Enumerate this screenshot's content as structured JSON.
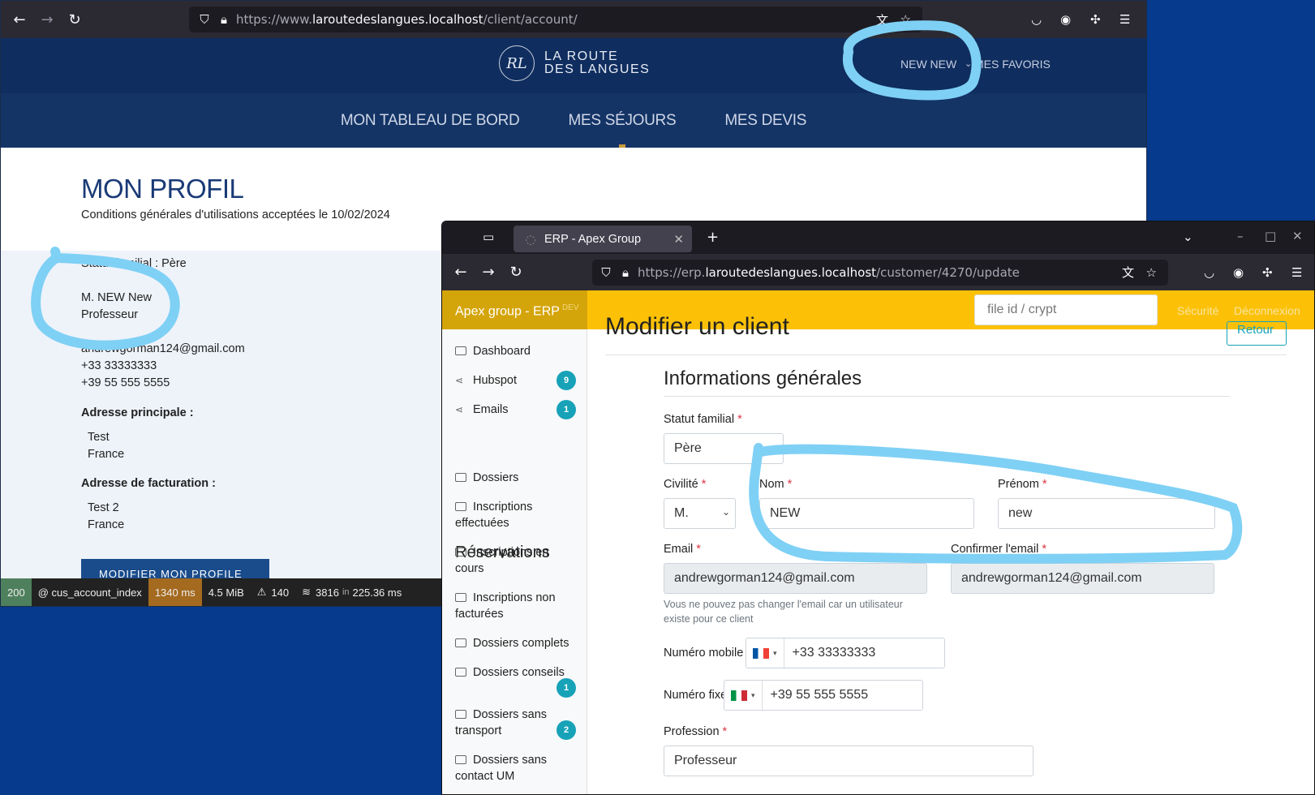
{
  "browser1": {
    "url_prefix": "https://www.",
    "url_host": "laroutedeslangues.localhost",
    "url_path": "/client/account/"
  },
  "site": {
    "logo_monogram": "RL",
    "logo_line1": "LA ROUTE",
    "logo_line2": "DES LANGUES",
    "user_menu": "NEW NEW",
    "favorites": "MES FAVORIS",
    "nav": [
      "MON TABLEAU DE BORD",
      "MES SÉJOURS",
      "MES DEVIS"
    ],
    "active_nav": "MES SÉJOURS"
  },
  "profile": {
    "title": "MON PROFIL",
    "cgu": "Conditions générales d'utilisations acceptées le 10/02/2024",
    "statut": "Statut familial : Père",
    "name": "M. NEW New",
    "profession": "Professeur",
    "email": "andrewgorman124@gmail.com",
    "phone1": "+33 33333333",
    "phone2": "+39 55 555 5555",
    "addr_main_label": "Adresse principale :",
    "addr_main_line1": "Test",
    "addr_main_line2": "France",
    "addr_bill_label": "Adresse de facturation :",
    "addr_bill_line1": "Test 2",
    "addr_bill_line2": "France",
    "edit_button": "MODIFIER MON PROFILE"
  },
  "debug": {
    "status": "200",
    "route": "@ cus_account_index",
    "time": "1340 ms",
    "memory": "4.5 MiB",
    "logs": "140",
    "cache_count": "3816",
    "cache_time": "225.36 ms"
  },
  "browser2": {
    "tab_title": "ERP - Apex Group",
    "url_prefix": "https://erp.",
    "url_host": "laroutedeslangues.localhost",
    "url_path": "/customer/4270/update"
  },
  "erp": {
    "brand": "Apex group - ERP",
    "brand_tag": "DEV",
    "search_placeholder": "file id / crypt",
    "link_security": "Sécurité",
    "link_logout": "Déconnexion",
    "page_title": "Modifier un client",
    "back_button": "Retour",
    "sidebar": {
      "dashboard": "Dashboard",
      "hubspot": "Hubspot",
      "hubspot_badge": "9",
      "emails": "Emails",
      "emails_badge": "1",
      "reservations_heading": "Réservations",
      "dossiers": "Dossiers",
      "inscriptions_effectuees": "Inscriptions effectuées",
      "inscriptions_en_cours": "Inscriptions en cours",
      "inscriptions_non_facturees": "Inscriptions non facturées",
      "dossiers_complets": "Dossiers complets",
      "dossiers_conseils": "Dossiers conseils",
      "dossiers_conseils_badge": "1",
      "dossiers_sans_transport": "Dossiers sans transport",
      "dossiers_sans_transport_badge": "2",
      "dossiers_sans_contact": "Dossiers sans contact UM"
    },
    "form": {
      "section_title": "Informations générales",
      "statut_label": "Statut familial",
      "statut_value": "Père",
      "civilite_label": "Civilité",
      "civilite_value": "M.",
      "nom_label": "Nom",
      "nom_value": "NEW",
      "prenom_label": "Prénom",
      "prenom_value": "new",
      "email_label": "Email",
      "email_value": "andrewgorman124@gmail.com",
      "confirm_email_label": "Confirmer l'email",
      "confirm_email_value": "andrewgorman124@gmail.com",
      "email_help": "Vous ne pouvez pas changer l'email car un utilisateur existe pour ce client",
      "mobile_label": "Numéro mobile",
      "mobile_value": "+33 33333333",
      "fixe_label": "Numéro fixe",
      "fixe_value": "+39 55 555 5555",
      "profession_label": "Profession",
      "profession_value": "Professeur",
      "required_mark": "*"
    }
  },
  "colors": {
    "desktop": "#063a8c",
    "site_header": "#0f2d5e",
    "erp_accent": "#fcc107",
    "annotation": "#7fd0f5"
  }
}
